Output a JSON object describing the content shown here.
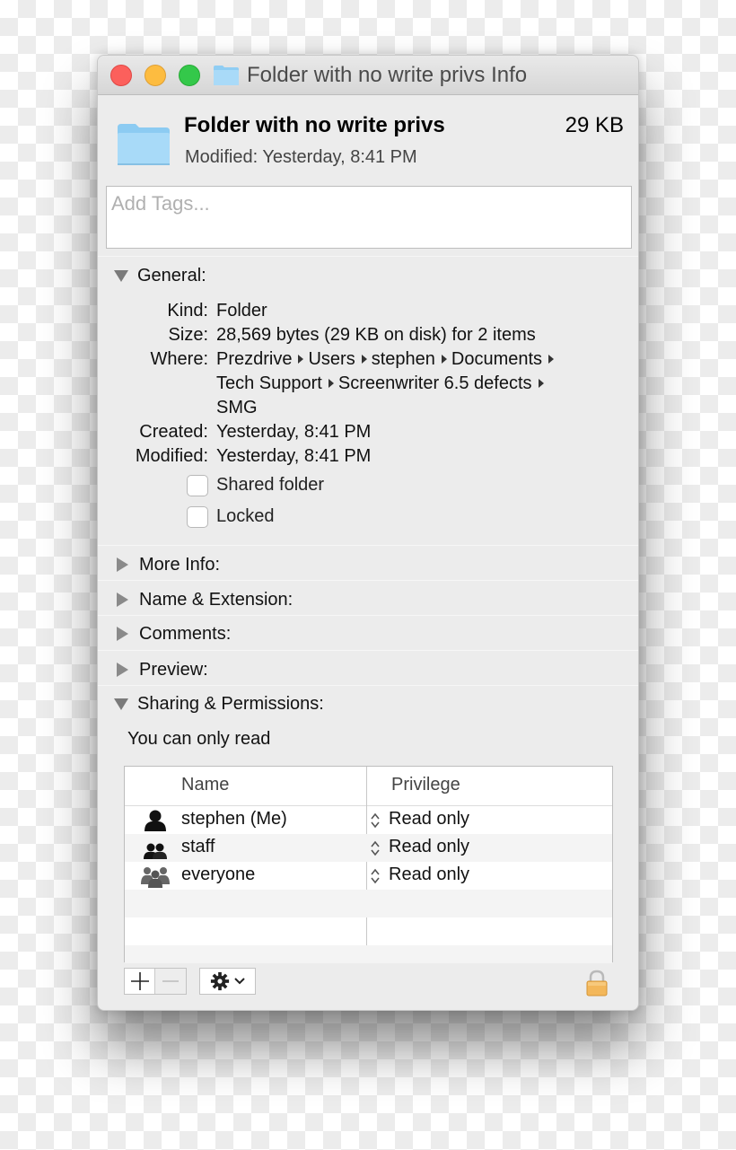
{
  "window": {
    "title": "Folder with no write privs Info",
    "traffic_lights": {
      "close": "close-button",
      "minimize": "minimize-button",
      "zoom": "zoom-button"
    }
  },
  "header": {
    "name": "Folder with no write privs",
    "size": "29 KB",
    "modified": "Modified:  Yesterday, 8:41 PM",
    "icon": "folder-icon"
  },
  "tags": {
    "placeholder": "Add Tags..."
  },
  "general": {
    "title": "General:",
    "expanded": true,
    "rows": [
      {
        "label": "Kind:",
        "value": "Folder"
      },
      {
        "label": "Size:",
        "value": "28,569 bytes (29 KB on disk) for 2 items"
      },
      {
        "label": "Where:",
        "path_line1": [
          "Prezdrive",
          "Users",
          "stephen",
          "Documents"
        ],
        "path_line2": [
          "Tech Support",
          "Screenwriter 6.5 defects"
        ],
        "path_line3": "SMG"
      },
      {
        "label": "Created:",
        "value": "Yesterday, 8:41 PM"
      },
      {
        "label": "Modified:",
        "value": "Yesterday, 8:41 PM"
      }
    ],
    "checkboxes": [
      {
        "label": "Shared folder",
        "checked": false
      },
      {
        "label": "Locked",
        "checked": false
      }
    ]
  },
  "sections": [
    {
      "title": "More Info:",
      "expanded": false
    },
    {
      "title": "Name & Extension:",
      "expanded": false
    },
    {
      "title": "Comments:",
      "expanded": false
    },
    {
      "title": "Preview:",
      "expanded": false
    }
  ],
  "sharing": {
    "title": "Sharing & Permissions:",
    "expanded": true,
    "note": "You can only read",
    "columns": [
      "Name",
      "Privilege"
    ],
    "rows": [
      {
        "name": "stephen (Me)",
        "privilege": "Read only",
        "icon": "user-icon"
      },
      {
        "name": "staff",
        "privilege": "Read only",
        "icon": "group-icon"
      },
      {
        "name": "everyone",
        "privilege": "Read only",
        "icon": "everyone-icon"
      }
    ],
    "controls": {
      "add": "+",
      "remove": "−",
      "action_menu": "gear-icon",
      "lock": "locked"
    }
  }
}
